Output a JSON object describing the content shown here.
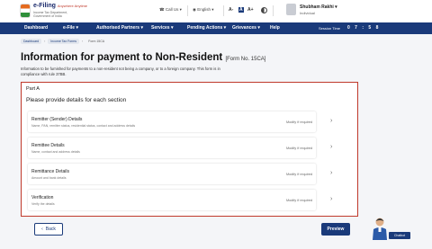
{
  "header": {
    "brand": "e-Filing",
    "brand_tag": "Anywhere Anytime",
    "brand_sub": "Income Tax Department, Government of India",
    "call_us": "Call Us",
    "language": "English",
    "font_sizes": [
      "A-",
      "A",
      "A+"
    ],
    "user_name": "Shubham Rakhi",
    "user_role": "Individual"
  },
  "nav": {
    "items": [
      "Dashboard",
      "e-File",
      "Authorised Partners",
      "Services",
      "Pending Actions",
      "Grievances",
      "Help"
    ],
    "session_label": "Session Time",
    "session_digits": "0 7 : 5 8"
  },
  "breadcrumb": [
    "Dashboard",
    "Income Tax Forms",
    "Form 15CA"
  ],
  "page": {
    "title": "Information for payment to Non-Resident",
    "form_no": "[Form No. 15CA]",
    "description": "Information to be furnished for payments to a non-resident not being a company, or to a foreign company. This form is in compliance with rule 37BB."
  },
  "part": {
    "label": "Part A",
    "heading": "Please provide details for each section",
    "sections": [
      {
        "title": "Remitter (Sender) Details",
        "subtitle": "Name, PAN, remitter status, residential status, contact and address details",
        "action": "Modify if required"
      },
      {
        "title": "Remittee Details",
        "subtitle": "Name, contact and address details",
        "action": "Modify if required"
      },
      {
        "title": "Remittance Details",
        "subtitle": "Amount and bank details",
        "action": "Modify if required"
      },
      {
        "title": "Verification",
        "subtitle": "Verify the details",
        "action": "Modify if required"
      }
    ]
  },
  "footer": {
    "back_label": "Back",
    "preview_label": "Preview",
    "chatbot_label": "Chatbot"
  }
}
